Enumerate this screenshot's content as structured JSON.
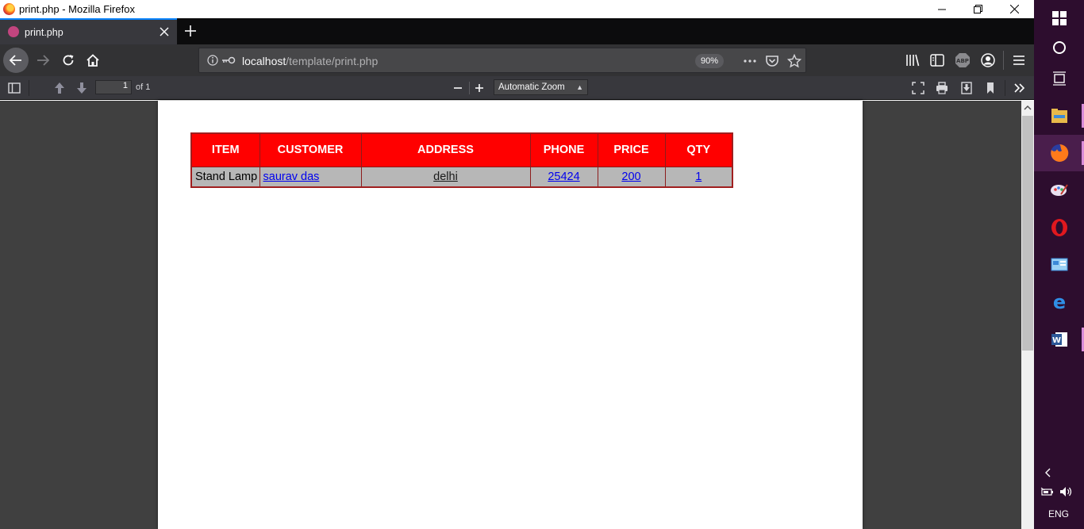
{
  "window": {
    "title": "print.php - Mozilla Firefox"
  },
  "tabs": [
    {
      "label": "print.php"
    }
  ],
  "navbar": {
    "url_host": "localhost",
    "url_path": "/template/print.php",
    "zoom_level": "90%"
  },
  "pdf_toolbar": {
    "page_number": "1",
    "page_count_label": "of 1",
    "zoom_mode": "Automatic Zoom"
  },
  "report_table": {
    "headers": [
      "ITEM",
      "CUSTOMER",
      "ADDRESS",
      "PHONE",
      "PRICE",
      "QTY"
    ],
    "rows": [
      {
        "item": "Stand Lamp",
        "customer": "saurav das",
        "address": "delhi",
        "phone": "25424",
        "price": "200",
        "qty": "1"
      }
    ]
  },
  "taskbar": {
    "language": "ENG",
    "apps": [
      "windows-start-icon",
      "cortana-icon",
      "task-view-icon",
      "file-explorer-icon",
      "firefox-icon",
      "paint-icon",
      "opera-icon",
      "control-panel-icon",
      "edge-icon",
      "word-icon"
    ]
  },
  "colors": {
    "header_bg": "#ff0000",
    "row_bg": "#b7b7b7",
    "link": "#0000ee",
    "taskbar_bg": "#2d0d2e",
    "firefox_dark": "#323234"
  }
}
